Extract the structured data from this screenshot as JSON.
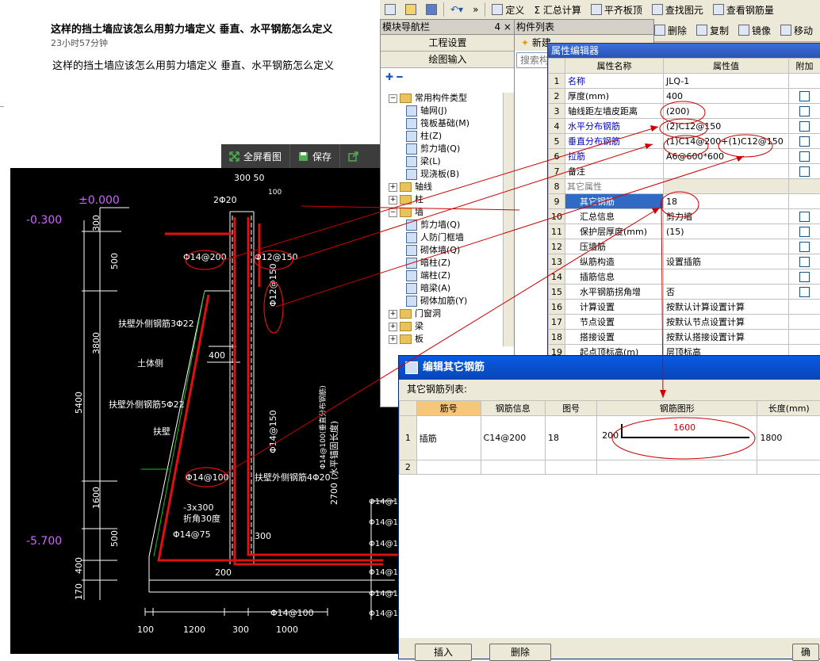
{
  "article": {
    "title": "这样的挡土墙应该怎么用剪力墙定义  垂直、水平钢筋怎么定义",
    "time": "23小时57分钟",
    "body": "这样的挡土墙应该怎么用剪力墙定义  垂直、水平钢筋怎么定义"
  },
  "viewer": {
    "fullscreen": "全屏看图",
    "save": "保存"
  },
  "toolbar": {
    "define": "定义",
    "sum": "Σ 汇总计算",
    "flat": "平齐板顶",
    "find": "查找图元",
    "view": "查看钢筋量",
    "delete": "删除",
    "copy": "复制",
    "mirror": "镜像",
    "move": "移动"
  },
  "nav": {
    "title": "模块导航栏",
    "pin": "4 ×",
    "btn1": "工程设置",
    "btn2": "绘图输入",
    "tree": [
      {
        "label": "常用构件类型",
        "level": 1,
        "exp": "−"
      },
      {
        "label": "轴网(J)",
        "level": 2
      },
      {
        "label": "筏板基础(M)",
        "level": 2
      },
      {
        "label": "柱(Z)",
        "level": 2
      },
      {
        "label": "剪力墙(Q)",
        "level": 2
      },
      {
        "label": "梁(L)",
        "level": 2
      },
      {
        "label": "现浇板(B)",
        "level": 2
      },
      {
        "label": "轴线",
        "level": 1,
        "exp": "+"
      },
      {
        "label": "柱",
        "level": 1,
        "exp": "+"
      },
      {
        "label": "墙",
        "level": 1,
        "exp": "−"
      },
      {
        "label": "剪力墙(Q)",
        "level": 2
      },
      {
        "label": "人防门框墙",
        "level": 2
      },
      {
        "label": "砌体墙(Q)",
        "level": 2
      },
      {
        "label": "暗柱(Z)",
        "level": 2
      },
      {
        "label": "端柱(Z)",
        "level": 2
      },
      {
        "label": "暗梁(A)",
        "level": 2
      },
      {
        "label": "砌体加筋(Y)",
        "level": 2
      },
      {
        "label": "门窗洞",
        "level": 1,
        "exp": "+"
      },
      {
        "label": "梁",
        "level": 1,
        "exp": "+"
      },
      {
        "label": "板",
        "level": 1,
        "exp": "+"
      }
    ]
  },
  "list": {
    "title": "构件列表",
    "new": "新建",
    "search": "搜索构"
  },
  "prop": {
    "title": "属性编辑器",
    "headers": [
      "属性名称",
      "属性值",
      "附加"
    ],
    "rows": [
      {
        "n": "1",
        "name": "名称",
        "value": "JLQ-1",
        "blue": true,
        "chk": false
      },
      {
        "n": "2",
        "name": "厚度(mm)",
        "value": "400",
        "chk": true
      },
      {
        "n": "3",
        "name": "轴线距左墙皮距离",
        "value": "(200)",
        "chk": true
      },
      {
        "n": "4",
        "name": "水平分布钢筋",
        "value": "(2)C12@150",
        "blue": true,
        "chk": true
      },
      {
        "n": "5",
        "name": "垂直分布钢筋",
        "value": "(1)C14@200+(1)C12@150",
        "blue": true,
        "chk": true
      },
      {
        "n": "6",
        "name": "拉筋",
        "value": "A6@600*600",
        "blue": true,
        "chk": true
      },
      {
        "n": "7",
        "name": "备注",
        "value": "",
        "chk": true
      },
      {
        "n": "8",
        "name": "其它属性",
        "value": "",
        "group": true
      },
      {
        "n": "9",
        "name": "其它钢筋",
        "value": "18",
        "sel": true
      },
      {
        "n": "10",
        "name": "汇总信息",
        "value": "剪力墙",
        "chk": true
      },
      {
        "n": "11",
        "name": "保护层厚度(mm)",
        "value": "(15)",
        "chk": true
      },
      {
        "n": "12",
        "name": "压墙筋",
        "value": "",
        "chk": true
      },
      {
        "n": "13",
        "name": "纵筋构造",
        "value": "设置插筋",
        "chk": true
      },
      {
        "n": "14",
        "name": "插筋信息",
        "value": "",
        "chk": true
      },
      {
        "n": "15",
        "name": "水平钢筋拐角增",
        "value": "否",
        "chk": true
      },
      {
        "n": "16",
        "name": "计算设置",
        "value": "按默认计算设置计算",
        "chk": false
      },
      {
        "n": "17",
        "name": "节点设置",
        "value": "按默认节点设置计算",
        "chk": false
      },
      {
        "n": "18",
        "name": "搭接设置",
        "value": "按默认搭接设置计算",
        "chk": false
      },
      {
        "n": "19",
        "name": "起点顶标高(m)",
        "value": "层顶标高",
        "chk": false
      }
    ]
  },
  "dialog": {
    "title": "编辑其它钢筋",
    "list_label": "其它钢筋列表:",
    "headers": [
      "筋号",
      "钢筋信息",
      "图号",
      "钢筋图形",
      "长度(mm)"
    ],
    "rows": [
      {
        "n": "1",
        "jin": "插筋",
        "info": "C14@200",
        "tu": "18",
        "shape_left": "200",
        "shape_len": "1600",
        "len": "1800"
      },
      {
        "n": "2",
        "jin": "",
        "info": "",
        "tu": "",
        "shape_left": "",
        "shape_len": "",
        "len": ""
      }
    ],
    "btn_insert": "插入",
    "btn_delete": "删除",
    "btn_ok": "确"
  },
  "cad": {
    "labels": {
      "elev1": "±0.000",
      "elev2": "-0.300",
      "elev3": "-5.700",
      "dim_top": "300 50",
      "dim_2": "2Φ20",
      "dim_100": "100",
      "r1": "Φ14@200",
      "r2": "Φ12@150",
      "r3": "Φ12@150",
      "t1": "扶壁外侧钢筋3Φ22",
      "t2": "土体侧",
      "t3": "扶壁外侧钢筋5Φ22",
      "t4": "扶壁",
      "d400": "400",
      "r4": "Φ14@150",
      "r5": "Φ14@100",
      "t5": "扶壁外侧钢筋4Φ20",
      "t6": "-3x300",
      "t7": "折角30度",
      "t8": "Φ14@75",
      "d300": "300",
      "d200": "200",
      "v2700": "2700 (水平锚固长度)",
      "v_note": "Φ14@100(垂直分布钢筋)",
      "b1": "Φ14@100",
      "v300": "300",
      "v500": "500",
      "v3800": "3800",
      "v5400": "5400",
      "v1600": "1600",
      "v500b": "500",
      "v400": "400",
      "v170": "170",
      "h100": "100",
      "h1200": "1200",
      "h300": "300",
      "h1000": "1000",
      "rs1": "Φ14@15",
      "rs2": "Φ14@15",
      "rs3": "Φ14@15",
      "rs4": "Φ14@15",
      "rs5": "Φ14@15",
      "rs6": "Φ14@15"
    }
  },
  "colors": {
    "accent": "#0a5ae0",
    "annot": "#cc0000",
    "cad_bg": "#000000"
  }
}
